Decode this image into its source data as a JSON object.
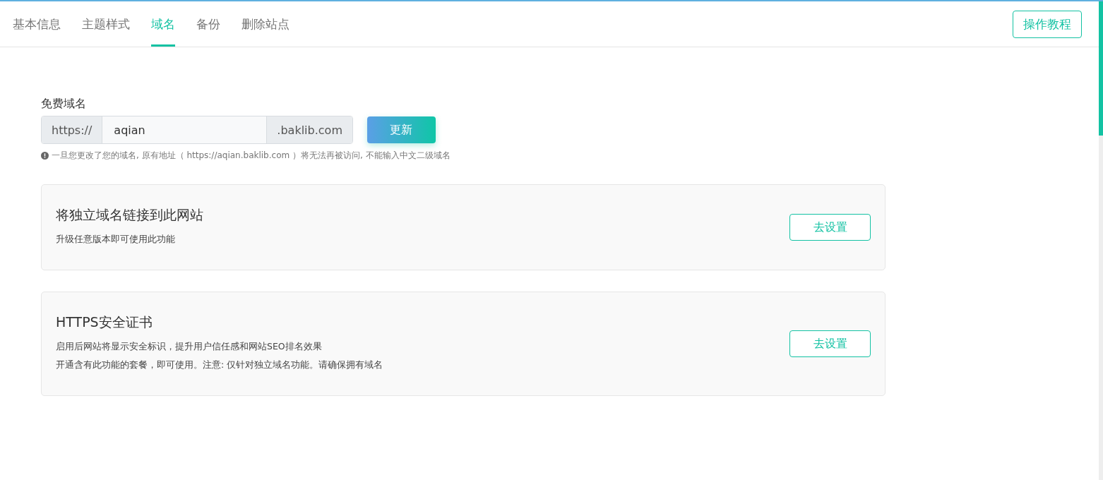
{
  "tabs": [
    {
      "label": "基本信息",
      "selected": false
    },
    {
      "label": "主题样式",
      "selected": false
    },
    {
      "label": "域名",
      "selected": true
    },
    {
      "label": "备份",
      "selected": false
    },
    {
      "label": "删除站点",
      "selected": false
    }
  ],
  "tutorial_button": "操作教程",
  "free_domain": {
    "label": "免费域名",
    "prefix": "https://",
    "value": "aqian",
    "suffix": ".baklib.com",
    "button": "更新",
    "notice": "一旦您更改了您的域名, 原有地址（ https://aqian.baklib.com ）将无法再被访问, 不能输入中文二级域名"
  },
  "cards": [
    {
      "title": "将独立域名链接到此网站",
      "lines": [
        "升级任意版本即可使用此功能"
      ],
      "button": "去设置"
    },
    {
      "title": "HTTPS安全证书",
      "lines": [
        "启用后网站将显示安全标识，提升用户信任感和网站SEO排名效果",
        "开通含有此功能的套餐，即可使用。注意: 仅针对独立域名功能。请确保拥有域名"
      ],
      "button": "去设置"
    }
  ]
}
